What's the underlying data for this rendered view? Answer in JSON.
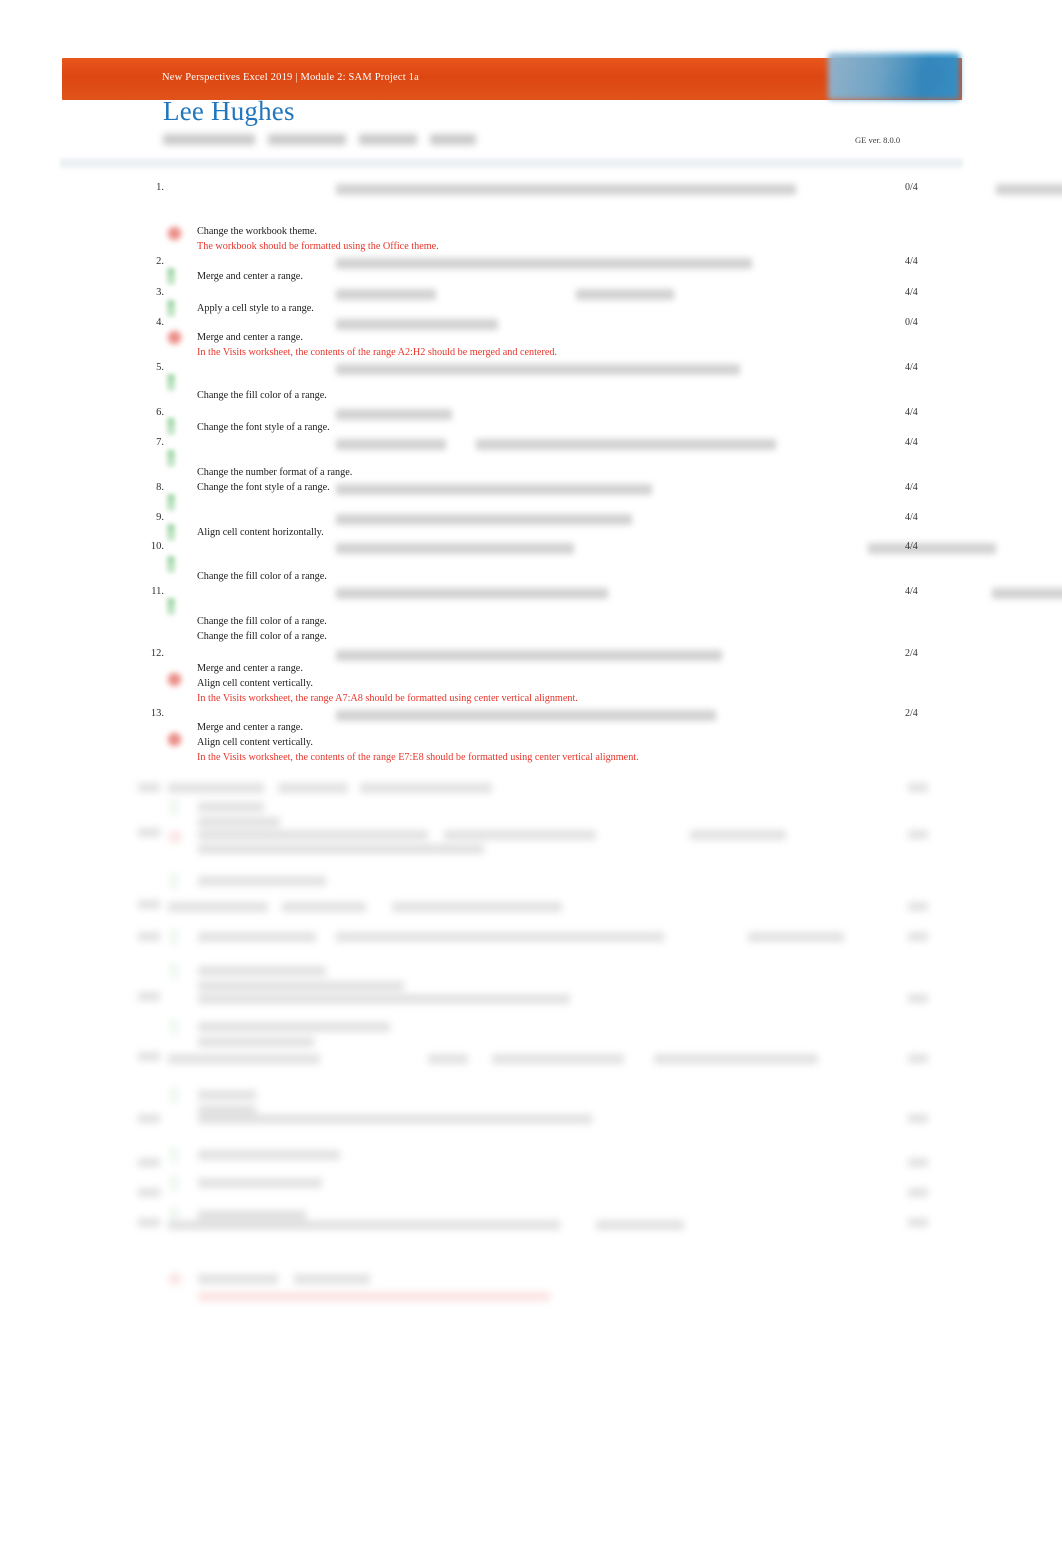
{
  "header": {
    "banner_text": "New Perspectives Excel 2019 | Module 2: SAM Project 1a",
    "student_name": "Lee Hughes",
    "version_label": "GE ver. 8.0.0",
    "brand_orange": "#dd4712",
    "name_blue": "#2176bd",
    "error_red": "#e8342a",
    "logo_icon": "sam-logo-icon"
  },
  "report": {
    "tasks": [
      {
        "number": "1.",
        "score": "0/4",
        "status": "incorrect",
        "results": [
          {
            "text": "Change the workbook theme.",
            "type": "label"
          },
          {
            "text": "The workbook should be formatted using the Office theme.",
            "type": "error"
          }
        ]
      },
      {
        "number": "2.",
        "score": "4/4",
        "status": "correct",
        "results": [
          {
            "text": "Merge and center a range.",
            "type": "label"
          }
        ]
      },
      {
        "number": "3.",
        "score": "4/4",
        "status": "correct",
        "results": [
          {
            "text": "Apply a cell style to a range.",
            "type": "label"
          }
        ]
      },
      {
        "number": "4.",
        "score": "0/4",
        "status": "incorrect",
        "results": [
          {
            "text": "Merge and center a range.",
            "type": "label"
          },
          {
            "text": "In the Visits worksheet, the contents of the range A2:H2 should be merged and centered.",
            "type": "error"
          }
        ]
      },
      {
        "number": "5.",
        "score": "4/4",
        "status": "correct",
        "results": [
          {
            "text": "Change the fill color of a range.",
            "type": "label"
          }
        ]
      },
      {
        "number": "6.",
        "score": "4/4",
        "status": "correct",
        "results": [
          {
            "text": "Change the font style of a range.",
            "type": "label"
          }
        ]
      },
      {
        "number": "7.",
        "score": "4/4",
        "status": "correct",
        "results": [
          {
            "text": "Change the number format of a range.",
            "type": "label"
          }
        ]
      },
      {
        "number": "8.",
        "score": "4/4",
        "status": "correct",
        "results": [
          {
            "text": "Change the font style of a range.",
            "type": "label"
          }
        ]
      },
      {
        "number": "9.",
        "score": "4/4",
        "status": "correct",
        "results": [
          {
            "text": "Align cell content horizontally.",
            "type": "label"
          }
        ]
      },
      {
        "number": "10.",
        "score": "4/4",
        "status": "correct",
        "results": [
          {
            "text": "Change the fill color of a range.",
            "type": "label"
          }
        ]
      },
      {
        "number": "11.",
        "score": "4/4",
        "status": "correct",
        "results": [
          {
            "text": "Change the fill color of a range.",
            "type": "label"
          },
          {
            "text": "Change the fill color of a range.",
            "type": "label"
          }
        ]
      },
      {
        "number": "12.",
        "score": "2/4",
        "status": "partial",
        "results": [
          {
            "text": "Merge and center a range.",
            "type": "label"
          },
          {
            "text": "Align cell content vertically.",
            "type": "label"
          },
          {
            "text": "In the Visits worksheet, the range A7:A8 should be formatted using center vertical alignment.",
            "type": "error"
          }
        ]
      },
      {
        "number": "13.",
        "score": "2/4",
        "status": "partial",
        "results": [
          {
            "text": "Merge and center a range.",
            "type": "label"
          },
          {
            "text": "Align cell content vertically.",
            "type": "label"
          },
          {
            "text": "In the Visits worksheet, the contents of the range E7:E8 should be formatted using center vertical alignment.",
            "type": "error"
          }
        ]
      }
    ]
  }
}
